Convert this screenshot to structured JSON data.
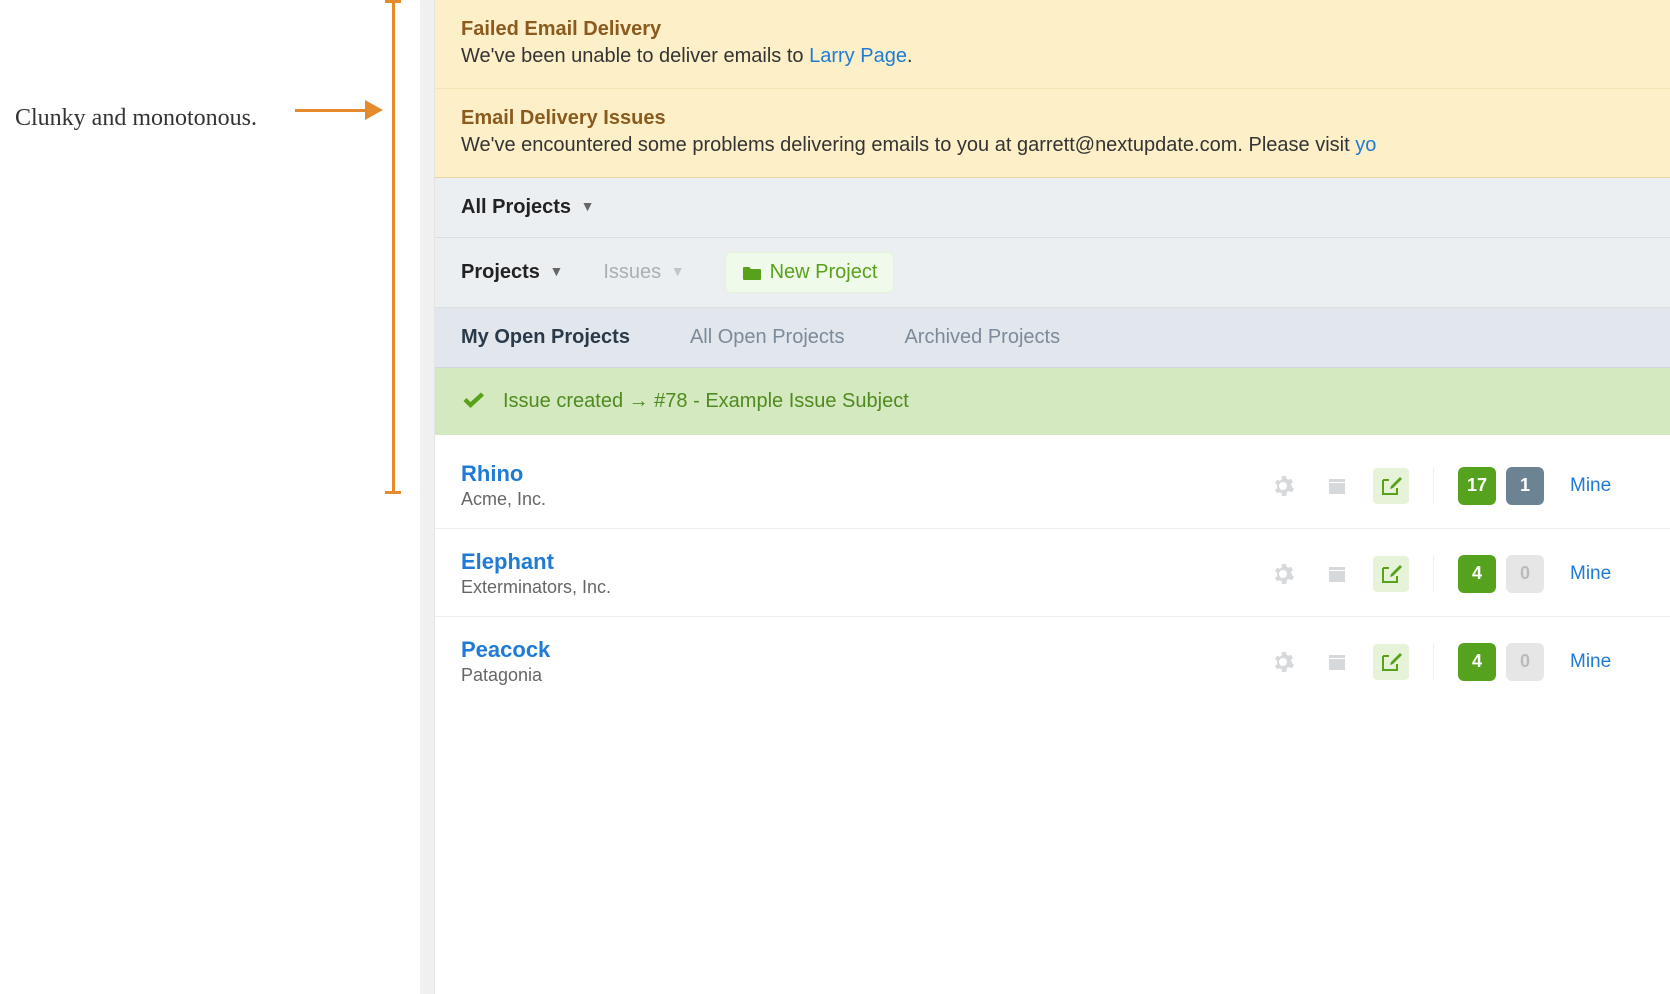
{
  "annotation": {
    "text": "Clunky and monotonous."
  },
  "alerts": [
    {
      "title": "Failed Email Delivery",
      "body_before": "We've been unable to deliver emails to ",
      "body_link": "Larry Page",
      "body_after": "."
    },
    {
      "title": "Email Delivery Issues",
      "body_before": "We've encountered some problems delivering emails to you at garrett@nextupdate.com. Please visit ",
      "body_link": "yo",
      "body_after": ""
    }
  ],
  "toolbar": {
    "all_projects": "All Projects",
    "projects": "Projects",
    "issues": "Issues",
    "new_project": "New Project"
  },
  "tabs": {
    "my_open": "My Open Projects",
    "all_open": "All Open Projects",
    "archived": "Archived Projects"
  },
  "flash": {
    "text": "Issue created → #78 - Example Issue Subject"
  },
  "projects": [
    {
      "name": "Rhino",
      "company": "Acme, Inc.",
      "count_a": "17",
      "count_b": "1",
      "count_b_style": "slate",
      "mine": "Mine"
    },
    {
      "name": "Elephant",
      "company": "Exterminators, Inc.",
      "count_a": "4",
      "count_b": "0",
      "count_b_style": "grey",
      "mine": "Mine"
    },
    {
      "name": "Peacock",
      "company": "Patagonia",
      "count_a": "4",
      "count_b": "0",
      "count_b_style": "grey",
      "mine": "Mine"
    }
  ]
}
